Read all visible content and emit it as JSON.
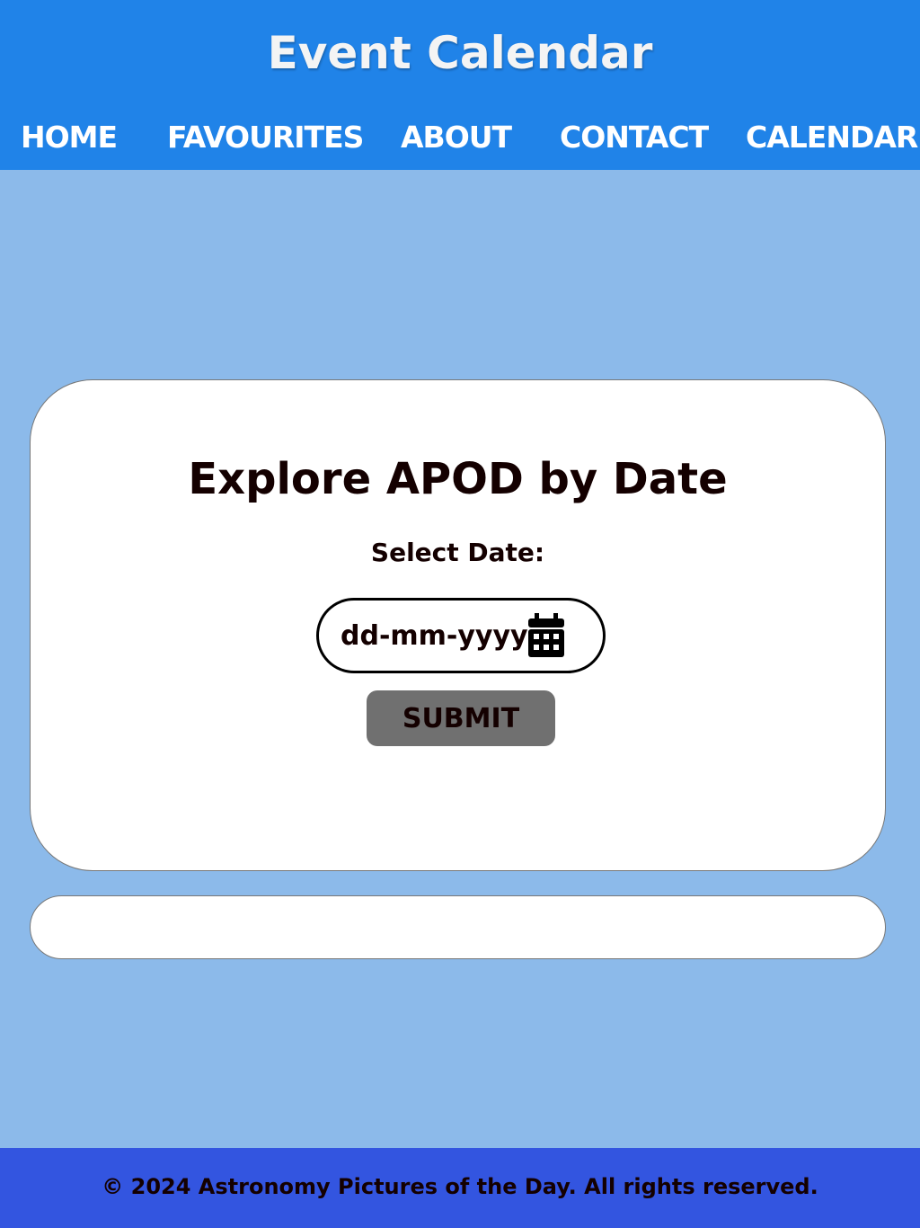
{
  "header": {
    "title": "Event Calendar"
  },
  "nav": {
    "items": [
      {
        "label": "HOME"
      },
      {
        "label": "FAVOURITES"
      },
      {
        "label": "ABOUT"
      },
      {
        "label": "CONTACT"
      },
      {
        "label": "CALENDAR"
      }
    ]
  },
  "main": {
    "heading": "Explore APOD by Date",
    "date_label": "Select Date:",
    "date_placeholder": "dd-mm-yyyy",
    "submit_label": "SUBMIT"
  },
  "footer": {
    "text": "© 2024 Astronomy Pictures of the Day. All rights reserved."
  },
  "colors": {
    "header": "#2083e8",
    "background": "#8cbaea",
    "footer": "#3355e0",
    "button": "#707070"
  }
}
